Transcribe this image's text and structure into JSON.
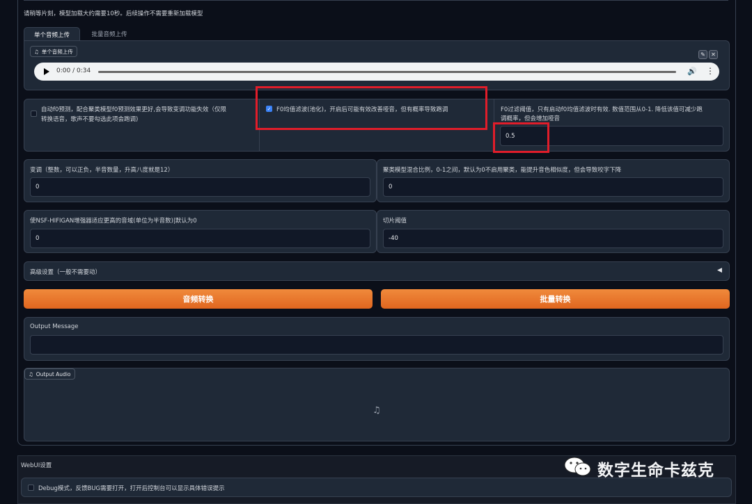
{
  "notice": "请稍等片刻，模型加载大约需要10秒。后续操作不需要重新加载模型",
  "tabs": [
    {
      "label": "单个音频上传",
      "active": true
    },
    {
      "label": "批量音频上传",
      "active": false
    }
  ],
  "upload": {
    "label": "单个音频上传",
    "time": "0:00 / 0:34",
    "progress": 0.0
  },
  "options": {
    "auto_f0": {
      "label_line1": "自动f0预测，配合聚类模型f0预测效果更好,会导致变调功能失效（仅限",
      "label_line2": "转换语音，歌声不要勾选此项会跑调)",
      "checked": false
    },
    "f0_filter": {
      "label": "F0均值滤波(池化)，开启后可能有效改善哑音，但有概率导致跑调",
      "checked": true
    },
    "f0_threshold": {
      "label_line1": "F0过滤阈值，只有启动f0均值滤波时有效. 数值范围从0-1. 降低该值可减少跑",
      "label_line2": "调概率，但会增加哑音",
      "value": "0.5"
    }
  },
  "transpose": {
    "label": "变调（整数，可以正负，半音数量，升高八度就是12）",
    "value": "0"
  },
  "cluster": {
    "label": "聚类模型混合比例，0-1之间，默认为0不启用聚类，能提升音色相似度，但会导致咬字下降",
    "value": "0"
  },
  "nsf": {
    "label": "使NSF-HIFIGAN增强器适应更高的音域(单位为半音数)|默认为0",
    "value": "0"
  },
  "slice": {
    "label": "切片阈值",
    "value": "-40"
  },
  "advanced": {
    "label": "高级设置（一般不需要动）",
    "arrow": "◀"
  },
  "buttons": {
    "convert": "音频转换",
    "batch": "批量转换"
  },
  "output_message": {
    "label": "Output Message",
    "value": ""
  },
  "output_audio": {
    "label": "Output Audio",
    "icon": "music-note-icon"
  },
  "webui": {
    "title": "WebUI设置",
    "debug_label": "Debug模式，反馈BUG需要打开，打开后控制台可以显示具体错误提示",
    "debug_checked": false
  },
  "watermark": {
    "text": "数字生命卡兹克"
  },
  "colors": {
    "accent": "#e8702a",
    "highlight": "#e11d2a",
    "checkbox": "#3b82f6"
  }
}
